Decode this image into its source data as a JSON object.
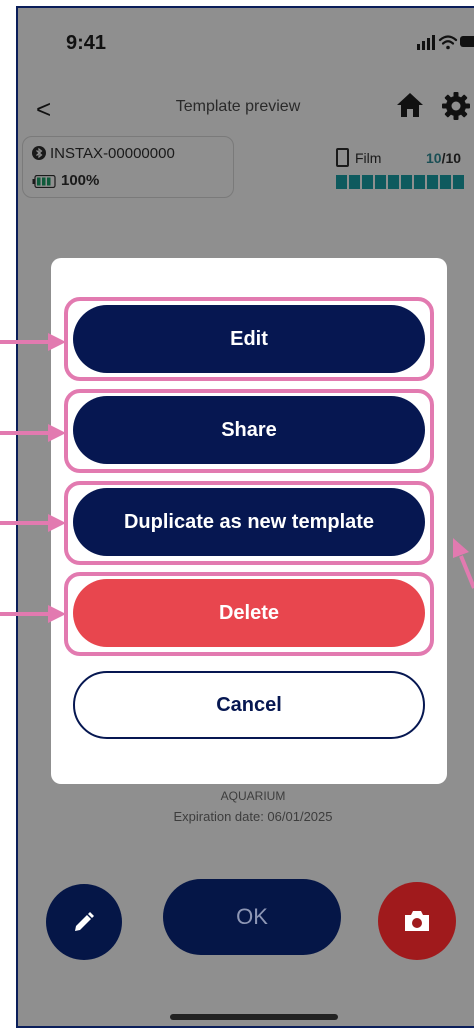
{
  "status_bar": {
    "time": "9:41"
  },
  "nav": {
    "back_glyph": "<",
    "title": "Template preview",
    "icons": [
      "home-icon",
      "gear-icon"
    ]
  },
  "device": {
    "name": "INSTAX-00000000",
    "battery": "100%",
    "film_label": "Film",
    "film_count": "10",
    "film_total": "/10",
    "film_remaining_fraction": 1.0
  },
  "template": {
    "title": "AQUARIUM",
    "expiration": "Expiration date: 06/01/2025"
  },
  "bottom": {
    "ok_label": "OK"
  },
  "modal": {
    "edit_label": "Edit",
    "share_label": "Share",
    "duplicate_label": "Duplicate as new template",
    "delete_label": "Delete",
    "cancel_label": "Cancel"
  },
  "colors": {
    "primary_navy": "#061751",
    "danger_red": "#e8464e",
    "highlight_pink": "#e27ab0",
    "film_teal": "#0e5a5e"
  }
}
